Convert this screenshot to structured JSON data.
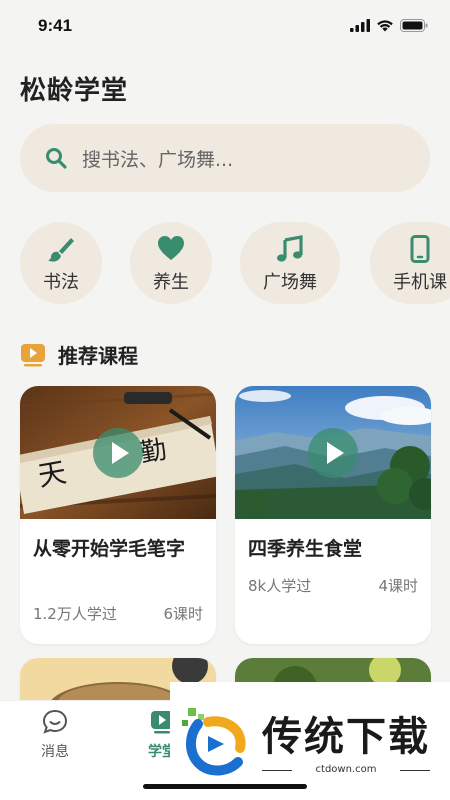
{
  "status": {
    "time": "9:41"
  },
  "app": {
    "title": "松龄学堂"
  },
  "search": {
    "placeholder": "搜书法、广场舞..."
  },
  "categories": [
    {
      "label": "书法",
      "icon": "brush-icon"
    },
    {
      "label": "养生",
      "icon": "heart-icon"
    },
    {
      "label": "广场舞",
      "icon": "music-note-icon"
    },
    {
      "label": "手机课",
      "icon": "phone-icon"
    }
  ],
  "section": {
    "title": "推荐课程",
    "icon": "video-play-icon"
  },
  "courses": [
    {
      "title": "从零开始学毛笔字",
      "learners": "1.2万人学过",
      "lessons": "6课时",
      "image": "calligraphy-photo"
    },
    {
      "title": "四季养生食堂",
      "learners": "8k人学过",
      "lessons": "4课时",
      "image": "mountain-landscape-photo"
    }
  ],
  "tabs": [
    {
      "label": "消息",
      "icon": "chat-bubble-icon",
      "active": false
    },
    {
      "label": "学堂",
      "icon": "video-play-icon",
      "active": true
    }
  ],
  "watermark": {
    "brand": "传统下载",
    "url": "ctdown.com"
  },
  "colors": {
    "accent": "#3a8c6e",
    "chip_bg": "#efe9e0",
    "section_icon": "#e8a33a"
  }
}
